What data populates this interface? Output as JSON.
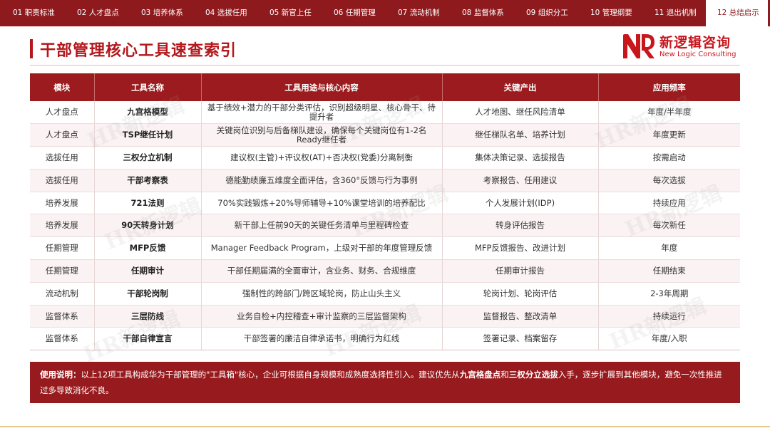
{
  "nav": {
    "tabs": [
      {
        "label": "01 职责标准",
        "active": false
      },
      {
        "label": "02 人才盘点",
        "active": false
      },
      {
        "label": "03 培养体系",
        "active": false
      },
      {
        "label": "04 选拔任用",
        "active": false
      },
      {
        "label": "05 新官上任",
        "active": false
      },
      {
        "label": "06 任期管理",
        "active": false
      },
      {
        "label": "07 流动机制",
        "active": false
      },
      {
        "label": "08 监督体系",
        "active": false
      },
      {
        "label": "09 组织分工",
        "active": false
      },
      {
        "label": "10 管理纲要",
        "active": false
      },
      {
        "label": "11 退出机制",
        "active": false
      },
      {
        "label": "12 总结启示",
        "active": true
      }
    ]
  },
  "header": {
    "title": "干部管理核心工具速查索引",
    "logo_cn": "新逻辑咨询",
    "logo_en": "New Logic Consulting"
  },
  "table": {
    "columns": [
      "模块",
      "工具名称",
      "工具用途与核心内容",
      "关键产出",
      "应用频率"
    ],
    "rows": [
      {
        "module": "人才盘点",
        "tool": "九宫格模型",
        "purpose": "基于绩效+潜力的干部分类评估，识别超级明星、核心骨干、待提升者",
        "output": "人才地图、继任风险清单",
        "freq": "年度/半年度"
      },
      {
        "module": "人才盘点",
        "tool": "TSP继任计划",
        "purpose": "关键岗位识别与后备梯队建设，确保每个关键岗位有1-2名Ready继任者",
        "output": "继任梯队名单、培养计划",
        "freq": "年度更新"
      },
      {
        "module": "选拔任用",
        "tool": "三权分立机制",
        "purpose": "建议权(主管)+评议权(AT)+否决权(党委)分离制衡",
        "output": "集体决策记录、选拔报告",
        "freq": "按需启动"
      },
      {
        "module": "选拔任用",
        "tool": "干部考察表",
        "purpose": "德能勤绩廉五维度全面评估，含360°反馈与行为事例",
        "output": "考察报告、任用建议",
        "freq": "每次选拔"
      },
      {
        "module": "培养发展",
        "tool": "721法则",
        "purpose": "70%实践锻炼+20%导师辅导+10%课堂培训的培养配比",
        "output": "个人发展计划(IDP)",
        "freq": "持续应用"
      },
      {
        "module": "培养发展",
        "tool": "90天转身计划",
        "purpose": "新干部上任前90天的关键任务清单与里程碑检查",
        "output": "转身评估报告",
        "freq": "每次新任"
      },
      {
        "module": "任期管理",
        "tool": "MFP反馈",
        "purpose": "Manager Feedback Program，上级对干部的年度管理反馈",
        "output": "MFP反馈报告、改进计划",
        "freq": "年度"
      },
      {
        "module": "任期管理",
        "tool": "任期审计",
        "purpose": "干部任期届满的全面审计，含业务、财务、合规维度",
        "output": "任期审计报告",
        "freq": "任期结束"
      },
      {
        "module": "流动机制",
        "tool": "干部轮岗制",
        "purpose": "强制性的跨部门/跨区域轮岗，防止山头主义",
        "output": "轮岗计划、轮岗评估",
        "freq": "2-3年周期"
      },
      {
        "module": "监督体系",
        "tool": "三层防线",
        "purpose": "业务自检+内控稽查+审计监察的三层监督架构",
        "output": "监督报告、整改清单",
        "freq": "持续运行"
      },
      {
        "module": "监督体系",
        "tool": "干部自律宣言",
        "purpose": "干部签署的廉洁自律承诺书，明确行为红线",
        "output": "签署记录、档案留存",
        "freq": "年度/入职"
      }
    ]
  },
  "note": {
    "label": "使用说明：",
    "text1": "以上12项工具构成华为干部管理的\"工具箱\"核心，企业可根据自身规模和成熟度选择性引入。建议优先从",
    "bold1": "九宫格盘点",
    "text2": "和",
    "bold2": "三权分立选拔",
    "text3": "入手，逐步扩展到其他模块，避免一次性推进过多导致消化不良。"
  },
  "watermark": "HR新逻辑",
  "colors": {
    "brand": "#9b1b1e",
    "accent": "#b3181d",
    "row_alt": "#fbf3f3"
  }
}
